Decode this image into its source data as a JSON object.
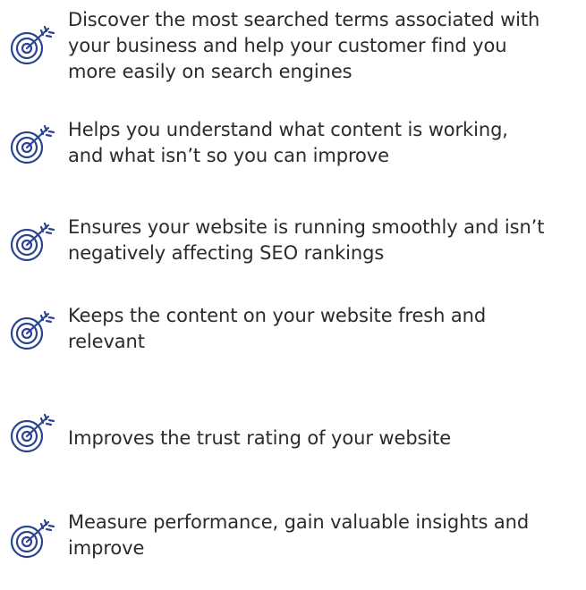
{
  "accent_color": "#2a4494",
  "icon_name": "target-arrow-icon",
  "items": [
    {
      "text": "Discover the most searched terms associated with\nyour business and help your customer find you\nmore easily on search engines"
    },
    {
      "text": "Helps you understand what content is working,\nand what isn’t so you can improve"
    },
    {
      "text": "Ensures your website is running smoothly and isn’t\nnegatively affecting SEO rankings"
    },
    {
      "text": "Keeps the content on your website fresh and\nrelevant"
    },
    {
      "text": "Improves the trust rating of your website"
    },
    {
      "text": "Measure performance, gain valuable insights and\nimprove"
    }
  ]
}
